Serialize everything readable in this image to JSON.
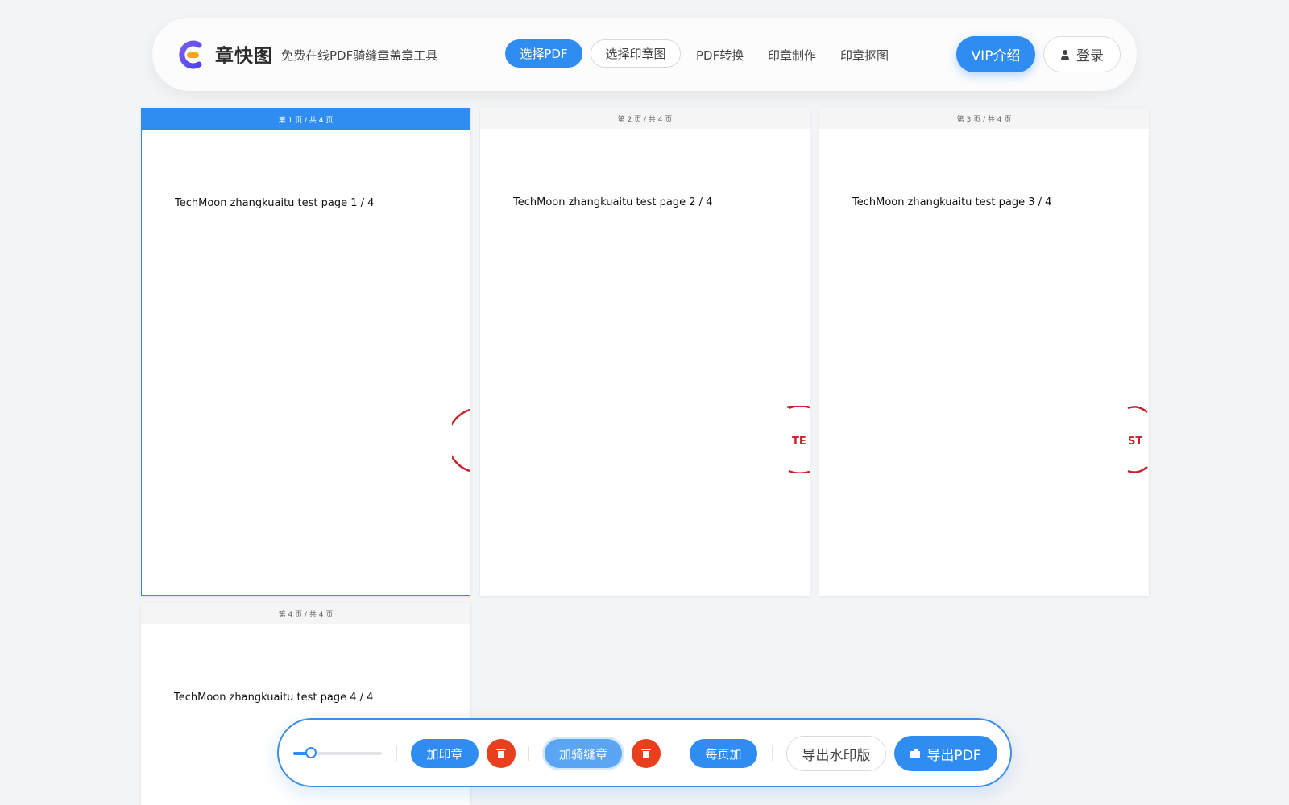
{
  "header": {
    "brand": "章快图",
    "tagline": "免费在线PDF骑缝章盖章工具",
    "select_pdf": "选择PDF",
    "select_seal": "选择印章图",
    "pdf_convert": "PDF转换",
    "seal_make": "印章制作",
    "seal_cutout": "印章抠图",
    "vip": "VIP介绍",
    "login": "登录"
  },
  "pages": [
    {
      "label": "第 1 页 / 共 4 页",
      "text": "TechMoon zhangkuaitu test page 1 / 4",
      "selected": true
    },
    {
      "label": "第 2 页 / 共 4 页",
      "text": "TechMoon zhangkuaitu test page 2 / 4",
      "seal_text": "TE"
    },
    {
      "label": "第 3 页 / 共 4 页",
      "text": "TechMoon zhangkuaitu test page 3 / 4",
      "seal_text": "ST"
    },
    {
      "label": "第 4 页 / 共 4 页",
      "text": "TechMoon zhangkuaitu test page 4 / 4"
    }
  ],
  "toolbar": {
    "seal_size_level": 0.2,
    "add_seal": "加印章",
    "add_riding_seal": "加骑缝章",
    "add_every_page": "每页加",
    "export_watermark": "导出水印版",
    "export_pdf": "导出PDF"
  },
  "colors": {
    "accent": "#2f8cf0",
    "danger": "#e8401f",
    "seal": "#c8232c"
  }
}
